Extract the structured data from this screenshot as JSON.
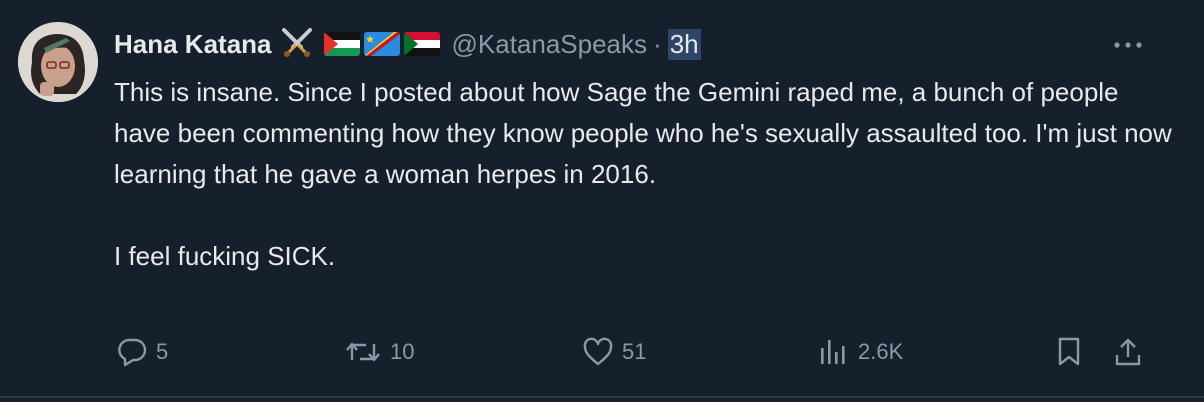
{
  "tweet": {
    "author_name": "Hana Katana",
    "handle": "@KatanaSpeaks",
    "separator": "·",
    "time": "3h",
    "name_emoji_icons": [
      "crossed-swords-icon",
      "palestine-flag-icon",
      "dr-congo-flag-icon",
      "sudan-flag-icon"
    ],
    "paragraphs": [
      "This is insane. Since I posted about how Sage the Gemini raped me, a bunch of people have been commenting how they know people who he's sexually assaulted too. I'm just now learning that he gave a woman herpes in 2016.",
      "I feel fucking SICK."
    ]
  },
  "actions": {
    "replies": "5",
    "reposts": "10",
    "likes": "51",
    "views": "2.6K"
  },
  "colors": {
    "background": "#16202c",
    "text": "#e7e9ea",
    "muted": "#8b98a5",
    "highlight": "#2d4566"
  }
}
